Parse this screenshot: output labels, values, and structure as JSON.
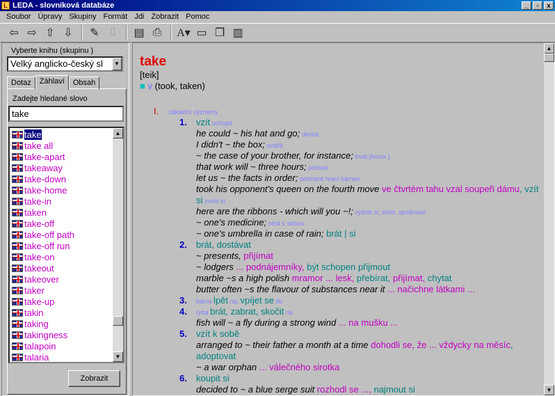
{
  "window": {
    "title": "LEDA - slovníková databáze",
    "buttons": [
      "_",
      "▫",
      "x"
    ]
  },
  "menu": [
    "Soubor",
    "Úpravy",
    "Skupiny",
    "Formát",
    "Jdi",
    "Zobrazit",
    "Pomoc"
  ],
  "left": {
    "book_label": "Vyberte knihu (skupinu )",
    "book_value": "Velký anglicko-český sl",
    "tabs": [
      "Dotaz",
      "Záhlaví",
      "Obsah"
    ],
    "search_label": "Zadejte hledané slovo",
    "search_value": "take",
    "words": [
      "take",
      "take all",
      "take-apart",
      "takeaway",
      "take-down",
      "take-home",
      "take-in",
      "taken",
      "take-off",
      "take-off path",
      "take-off run",
      "take-on",
      "takeout",
      "takeover",
      "taker",
      "take-up",
      "takin",
      "taking",
      "takingness",
      "talapoin",
      "talaria"
    ],
    "selected_word": "take",
    "show_button": "Zobrazit"
  },
  "entry": {
    "headword": "take",
    "pronunciation": "[teik]",
    "forms_dot": "■",
    "pos": "v",
    "forms": "(took, taken)",
    "sense_group": {
      "roman": "I.",
      "note": "základní významy"
    },
    "lines": [
      {
        "num": "1.",
        "parts": [
          {
            "c": "cz",
            "t": "vzít"
          },
          {
            "c": "note",
            "t": " uchopit"
          }
        ]
      },
      {
        "parts": [
          {
            "c": "ex",
            "t": "he could ~ his hat and go;"
          },
          {
            "c": "note",
            "t": " ukrást"
          }
        ]
      },
      {
        "parts": [
          {
            "c": "ex",
            "t": "I didn't ~ the box;"
          },
          {
            "c": "note",
            "t": " uvážit"
          }
        ]
      },
      {
        "parts": [
          {
            "c": "ex",
            "t": "~ the case of your brother, for instance;"
          },
          {
            "c": "note",
            "t": " trvat (hovor.)"
          }
        ]
      },
      {
        "parts": [
          {
            "c": "ex",
            "t": "that work will ~ three hours;"
          },
          {
            "c": "note",
            "t": " probrat"
          }
        ]
      },
      {
        "parts": [
          {
            "c": "ex",
            "t": "let us ~ the facts in order;"
          },
          {
            "c": "note",
            "t": " odstranit hrací kámen"
          }
        ]
      },
      {
        "parts": [
          {
            "c": "ex",
            "t": "took his opponent's queen on the fourth move "
          },
          {
            "c": "czm",
            "t": "ve čtvrtém tahu vzal soupeři dámu"
          },
          {
            "c": "cz",
            "t": ", vzít"
          }
        ]
      },
      {
        "parts": [
          {
            "c": "cz",
            "t": "si"
          },
          {
            "c": "note",
            "t": " zvolit si"
          }
        ]
      },
      {
        "parts": [
          {
            "c": "ex",
            "t": "here are the ribbons - which will you ~!;"
          },
          {
            "c": "note",
            "t": " vybrat si; sníst, spolknout"
          }
        ]
      },
      {
        "parts": [
          {
            "c": "ex",
            "t": "~ one's medicine;"
          },
          {
            "c": "note",
            "t": " nést s sebou"
          }
        ]
      },
      {
        "parts": [
          {
            "c": "ex",
            "t": "~ one's umbrella in case of rain;"
          },
          {
            "c": "cz",
            "t": " brát | si"
          }
        ]
      },
      {
        "num": "2.",
        "parts": [
          {
            "c": "cz",
            "t": "brát, dostávat"
          }
        ]
      },
      {
        "parts": [
          {
            "c": "ex",
            "t": "~ presents, "
          },
          {
            "c": "czm",
            "t": "přijímat"
          }
        ]
      },
      {
        "parts": [
          {
            "c": "ex",
            "t": "~ lodgers "
          },
          {
            "c": "czm",
            "t": "... podnájemníky, "
          },
          {
            "c": "cz",
            "t": "být schopen přijmout"
          }
        ]
      },
      {
        "parts": [
          {
            "c": "ex",
            "t": "marble ~s a high polish "
          },
          {
            "c": "czm",
            "t": "mramor ... lesk, "
          },
          {
            "c": "cz",
            "t": "přebírat, "
          },
          {
            "c": "czm",
            "t": "přijímat, "
          },
          {
            "c": "cz",
            "t": "chytat"
          }
        ]
      },
      {
        "parts": [
          {
            "c": "ex",
            "t": "butter often ~s the flavour of substances near it "
          },
          {
            "c": "czm",
            "t": "... načichne látkami ..."
          }
        ]
      },
      {
        "num": "3.",
        "parts": [
          {
            "c": "note",
            "t": "barva "
          },
          {
            "c": "cz",
            "t": "lpět"
          },
          {
            "c": "note",
            "t": " na, "
          },
          {
            "c": "cz",
            "t": "vpíjet se"
          },
          {
            "c": "note",
            "t": " do"
          }
        ]
      },
      {
        "num": "4.",
        "parts": [
          {
            "c": "note",
            "t": "ryba "
          },
          {
            "c": "cz",
            "t": "brát, zabrat, skočit"
          },
          {
            "c": "note",
            "t": " na"
          }
        ]
      },
      {
        "parts": [
          {
            "c": "ex",
            "t": "fish will ~ a fly during a strong wind "
          },
          {
            "c": "czm",
            "t": "... na mušku ..."
          }
        ]
      },
      {
        "num": "5.",
        "parts": [
          {
            "c": "cz",
            "t": "vzít k sobě"
          }
        ]
      },
      {
        "parts": [
          {
            "c": "ex",
            "t": "arranged to ~ their father a month at a time "
          },
          {
            "c": "czm",
            "t": "dohodli se, že ... vždycky na měsíc"
          },
          {
            "c": "cz",
            "t": ","
          }
        ]
      },
      {
        "parts": [
          {
            "c": "cz",
            "t": "adoptovat"
          }
        ]
      },
      {
        "parts": [
          {
            "c": "ex",
            "t": "~ a war orphan "
          },
          {
            "c": "czm",
            "t": "... válečného sirotka"
          }
        ]
      },
      {
        "num": "6.",
        "parts": [
          {
            "c": "cz",
            "t": "koupit si"
          }
        ]
      },
      {
        "parts": [
          {
            "c": "ex",
            "t": "decided to ~ a blue serge suit "
          },
          {
            "c": "czm",
            "t": "rozhodl se ...,"
          },
          {
            "c": "cz",
            "t": " najmout si"
          }
        ]
      }
    ]
  }
}
